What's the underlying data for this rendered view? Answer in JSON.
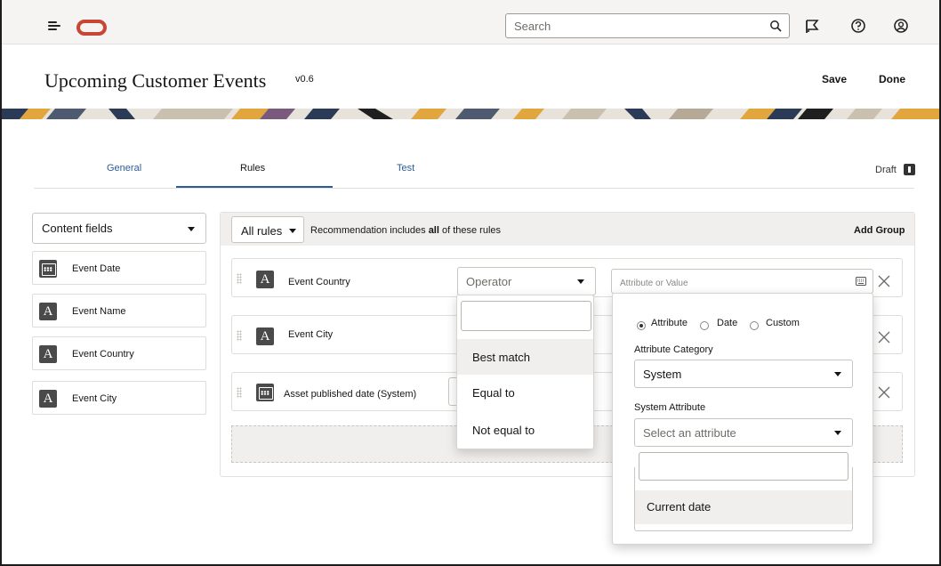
{
  "topbar": {
    "search_placeholder": "Search",
    "icons": [
      "menu-icon",
      "oracle-logo",
      "search-icon",
      "flag-icon",
      "help-icon",
      "user-icon"
    ],
    "brand_color": "#c74634"
  },
  "header": {
    "title": "Upcoming Customer Events",
    "version": "v0.6",
    "save_label": "Save",
    "done_label": "Done"
  },
  "tabs": {
    "items": [
      "General",
      "Rules",
      "Test"
    ],
    "active": "Rules",
    "status": "Draft"
  },
  "left_panel": {
    "selector_label": "Content fields",
    "fields": [
      {
        "label": "Event Date",
        "icon": "calendar-icon"
      },
      {
        "label": "Event Name",
        "icon": "text-type-icon"
      },
      {
        "label": "Event Country",
        "icon": "text-type-icon"
      },
      {
        "label": "Event City",
        "icon": "text-type-icon"
      }
    ]
  },
  "rules": {
    "selector_label": "All rules",
    "description_prefix": "Recommendation includes ",
    "description_bold": "all",
    "description_suffix": " of these rules",
    "add_group_label": "Add Group",
    "rows": [
      {
        "label": "Event Country",
        "icon": "text-type-icon",
        "operator_placeholder": "Operator",
        "value_placeholder": "Attribute or Value"
      },
      {
        "label": "Event City",
        "icon": "text-type-icon"
      },
      {
        "label": "Asset published date (System)",
        "icon": "calendar-icon"
      }
    ]
  },
  "operator_dropdown": {
    "options": [
      "Best match",
      "Equal to",
      "Not equal to"
    ],
    "highlighted": "Best match"
  },
  "attribute_popup": {
    "radio_options": [
      "Attribute",
      "Date",
      "Custom"
    ],
    "radio_selected": "Attribute",
    "category_label": "Attribute Category",
    "category_value": "System",
    "system_attribute_label": "System Attribute",
    "system_attribute_placeholder": "Select an attribute",
    "options": [
      "Current date"
    ]
  },
  "colors": {
    "link_blue": "#2b5d9b",
    "text": "#161513",
    "panel_gray": "#f1efed"
  }
}
